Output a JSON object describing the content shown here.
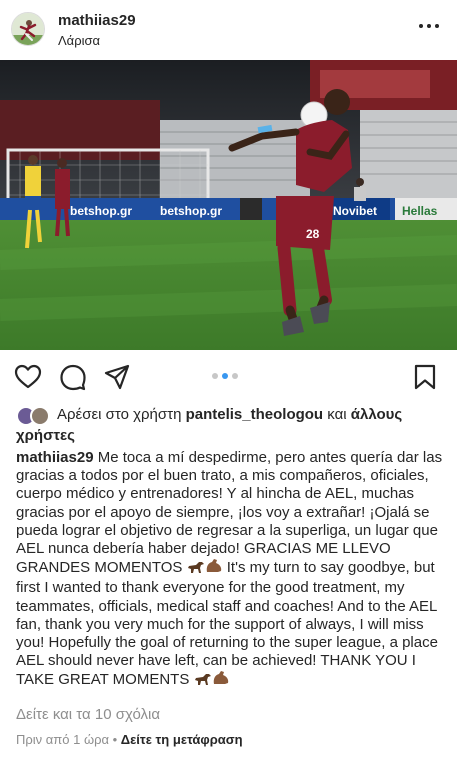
{
  "header": {
    "username": "mathiias29",
    "location": "Λάρισα"
  },
  "likes": {
    "prefix": "Αρέσει στο χρήστη ",
    "user": "pantelis_theologou",
    "middle": " και ",
    "others": "άλλους χρήστες"
  },
  "caption": {
    "username": "mathiias29",
    "text_es": " Me toca a mí despedirme, pero antes quería dar las gracias a todos por el buen trato, a mis compañeros, oficiales, cuerpo médico y entrenadores!  Y al hincha de AEL, muchas gracias por el apoyo de siempre, ¡los voy a extrañar! ¡Ojalá se pueda lograr el objetivo de regresar a la superliga, un lugar que AEL nunca debería haber dejado!  GRACIAS ME LLEVO GRANDES MOMENTOS ",
    "text_en": " It's my turn to say goodbye, but first I wanted to thank everyone for the good treatment, my teammates, officials, medical staff and coaches!  And to the AEL fan, thank you very much for the support of always, I will miss you!  Hopefully the goal of returning to the super league, a place AEL should never have left, can be achieved!  THANK YOU I TAKE GREAT MOMENTS "
  },
  "comments": {
    "view_all": "Δείτε και τα 10 σχόλια"
  },
  "meta": {
    "time": "Πριν από 1 ώρα",
    "separator": " • ",
    "translate": "Δείτε τη μετάφραση"
  },
  "carousel": {
    "total": 3,
    "active": 2
  },
  "photo": {
    "ads": [
      "betshop.gr",
      "betshop.gr",
      "Novibet",
      "Hellas"
    ],
    "jersey_number": "28"
  }
}
